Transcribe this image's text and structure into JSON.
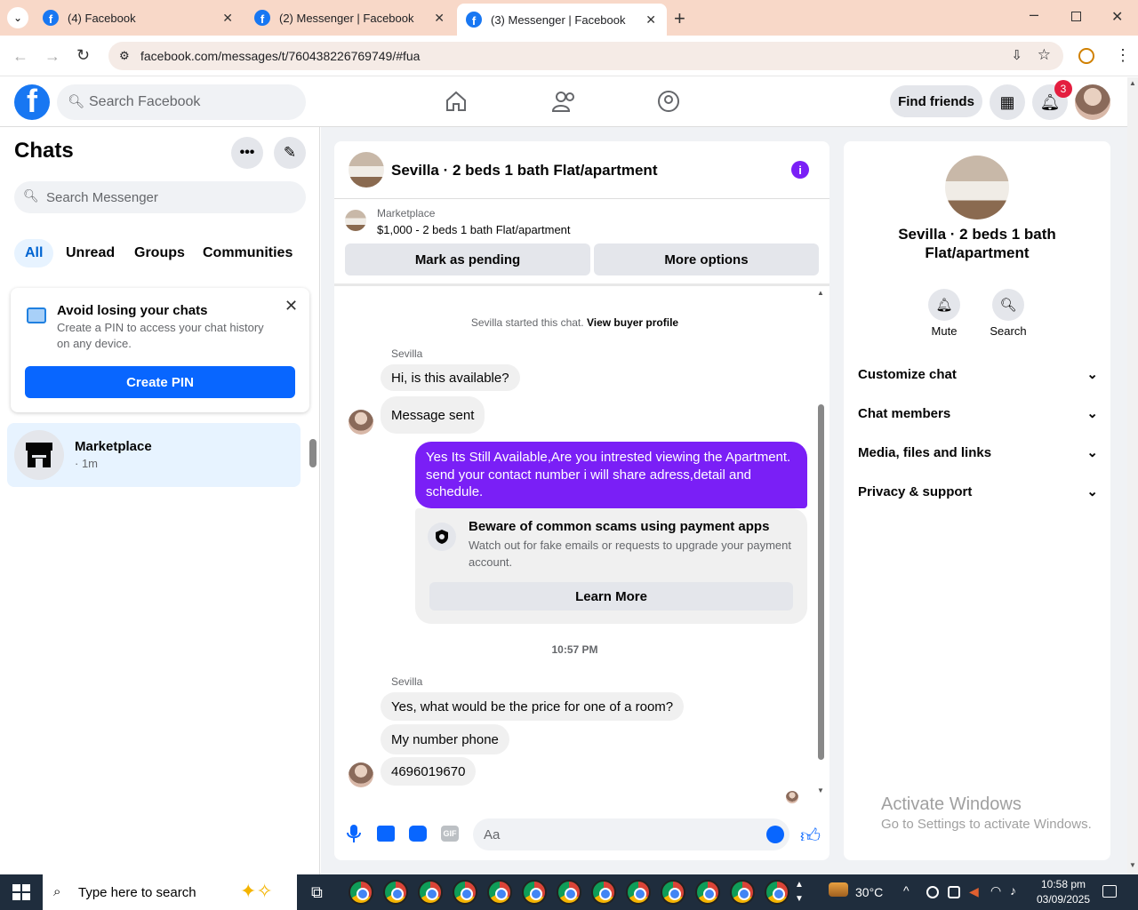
{
  "browser": {
    "tabs": [
      {
        "label": "(4) Facebook"
      },
      {
        "label": "(2) Messenger | Facebook"
      },
      {
        "label": "(3) Messenger | Facebook"
      }
    ],
    "url": "facebook.com/messages/t/760438226769749/#fua"
  },
  "fb": {
    "search_placeholder": "Search Facebook",
    "find_friends": "Find friends",
    "notif_count": "3"
  },
  "left": {
    "title": "Chats",
    "search_placeholder": "Search Messenger",
    "filters": [
      "All",
      "Unread",
      "Groups",
      "Communities"
    ],
    "pin": {
      "title": "Avoid losing your chats",
      "desc": "Create a PIN to access your chat history on any device.",
      "button": "Create PIN"
    },
    "chats": [
      {
        "name": "Marketplace",
        "time": "· 1m"
      }
    ]
  },
  "chat": {
    "title": "Sevilla · 2 beds 1 bath Flat/apartment",
    "market_label": "Marketplace",
    "listing": "$1,000 - 2 beds 1 bath Flat/apartment",
    "mark_pending": "Mark as pending",
    "more_options": "More options",
    "started": "Sevilla started this chat.",
    "view_profile": "View buyer profile",
    "sender": "Sevilla",
    "msgs1": [
      "Hi, is this available?",
      "Message sent"
    ],
    "my_msg": "Yes Its Still Available,Are you intrested viewing the Apartment. send your contact number i will share adress,detail and schedule.",
    "scam_title": "Beware of common scams using payment apps",
    "scam_desc": "Watch out for fake emails or requests to upgrade your payment account.",
    "learn_more": "Learn More",
    "time": "10:57 PM",
    "msgs2": [
      "Yes, what would be the price for one of a room?",
      "My number phone",
      "4696019670"
    ],
    "input_placeholder": "Aa",
    "accent": "#7a1ff6"
  },
  "right": {
    "title": "Sevilla · 2 beds 1 bath Flat/apartment",
    "mute": "Mute",
    "search": "Search",
    "sections": [
      "Customize chat",
      "Chat members",
      "Media, files and links",
      "Privacy & support"
    ],
    "activate_title": "Activate Windows",
    "activate_desc": "Go to Settings to activate Windows."
  },
  "taskbar": {
    "search_placeholder": "Type here to search",
    "temp": "30°C",
    "time": "10:58 pm",
    "date": "03/09/2025"
  }
}
